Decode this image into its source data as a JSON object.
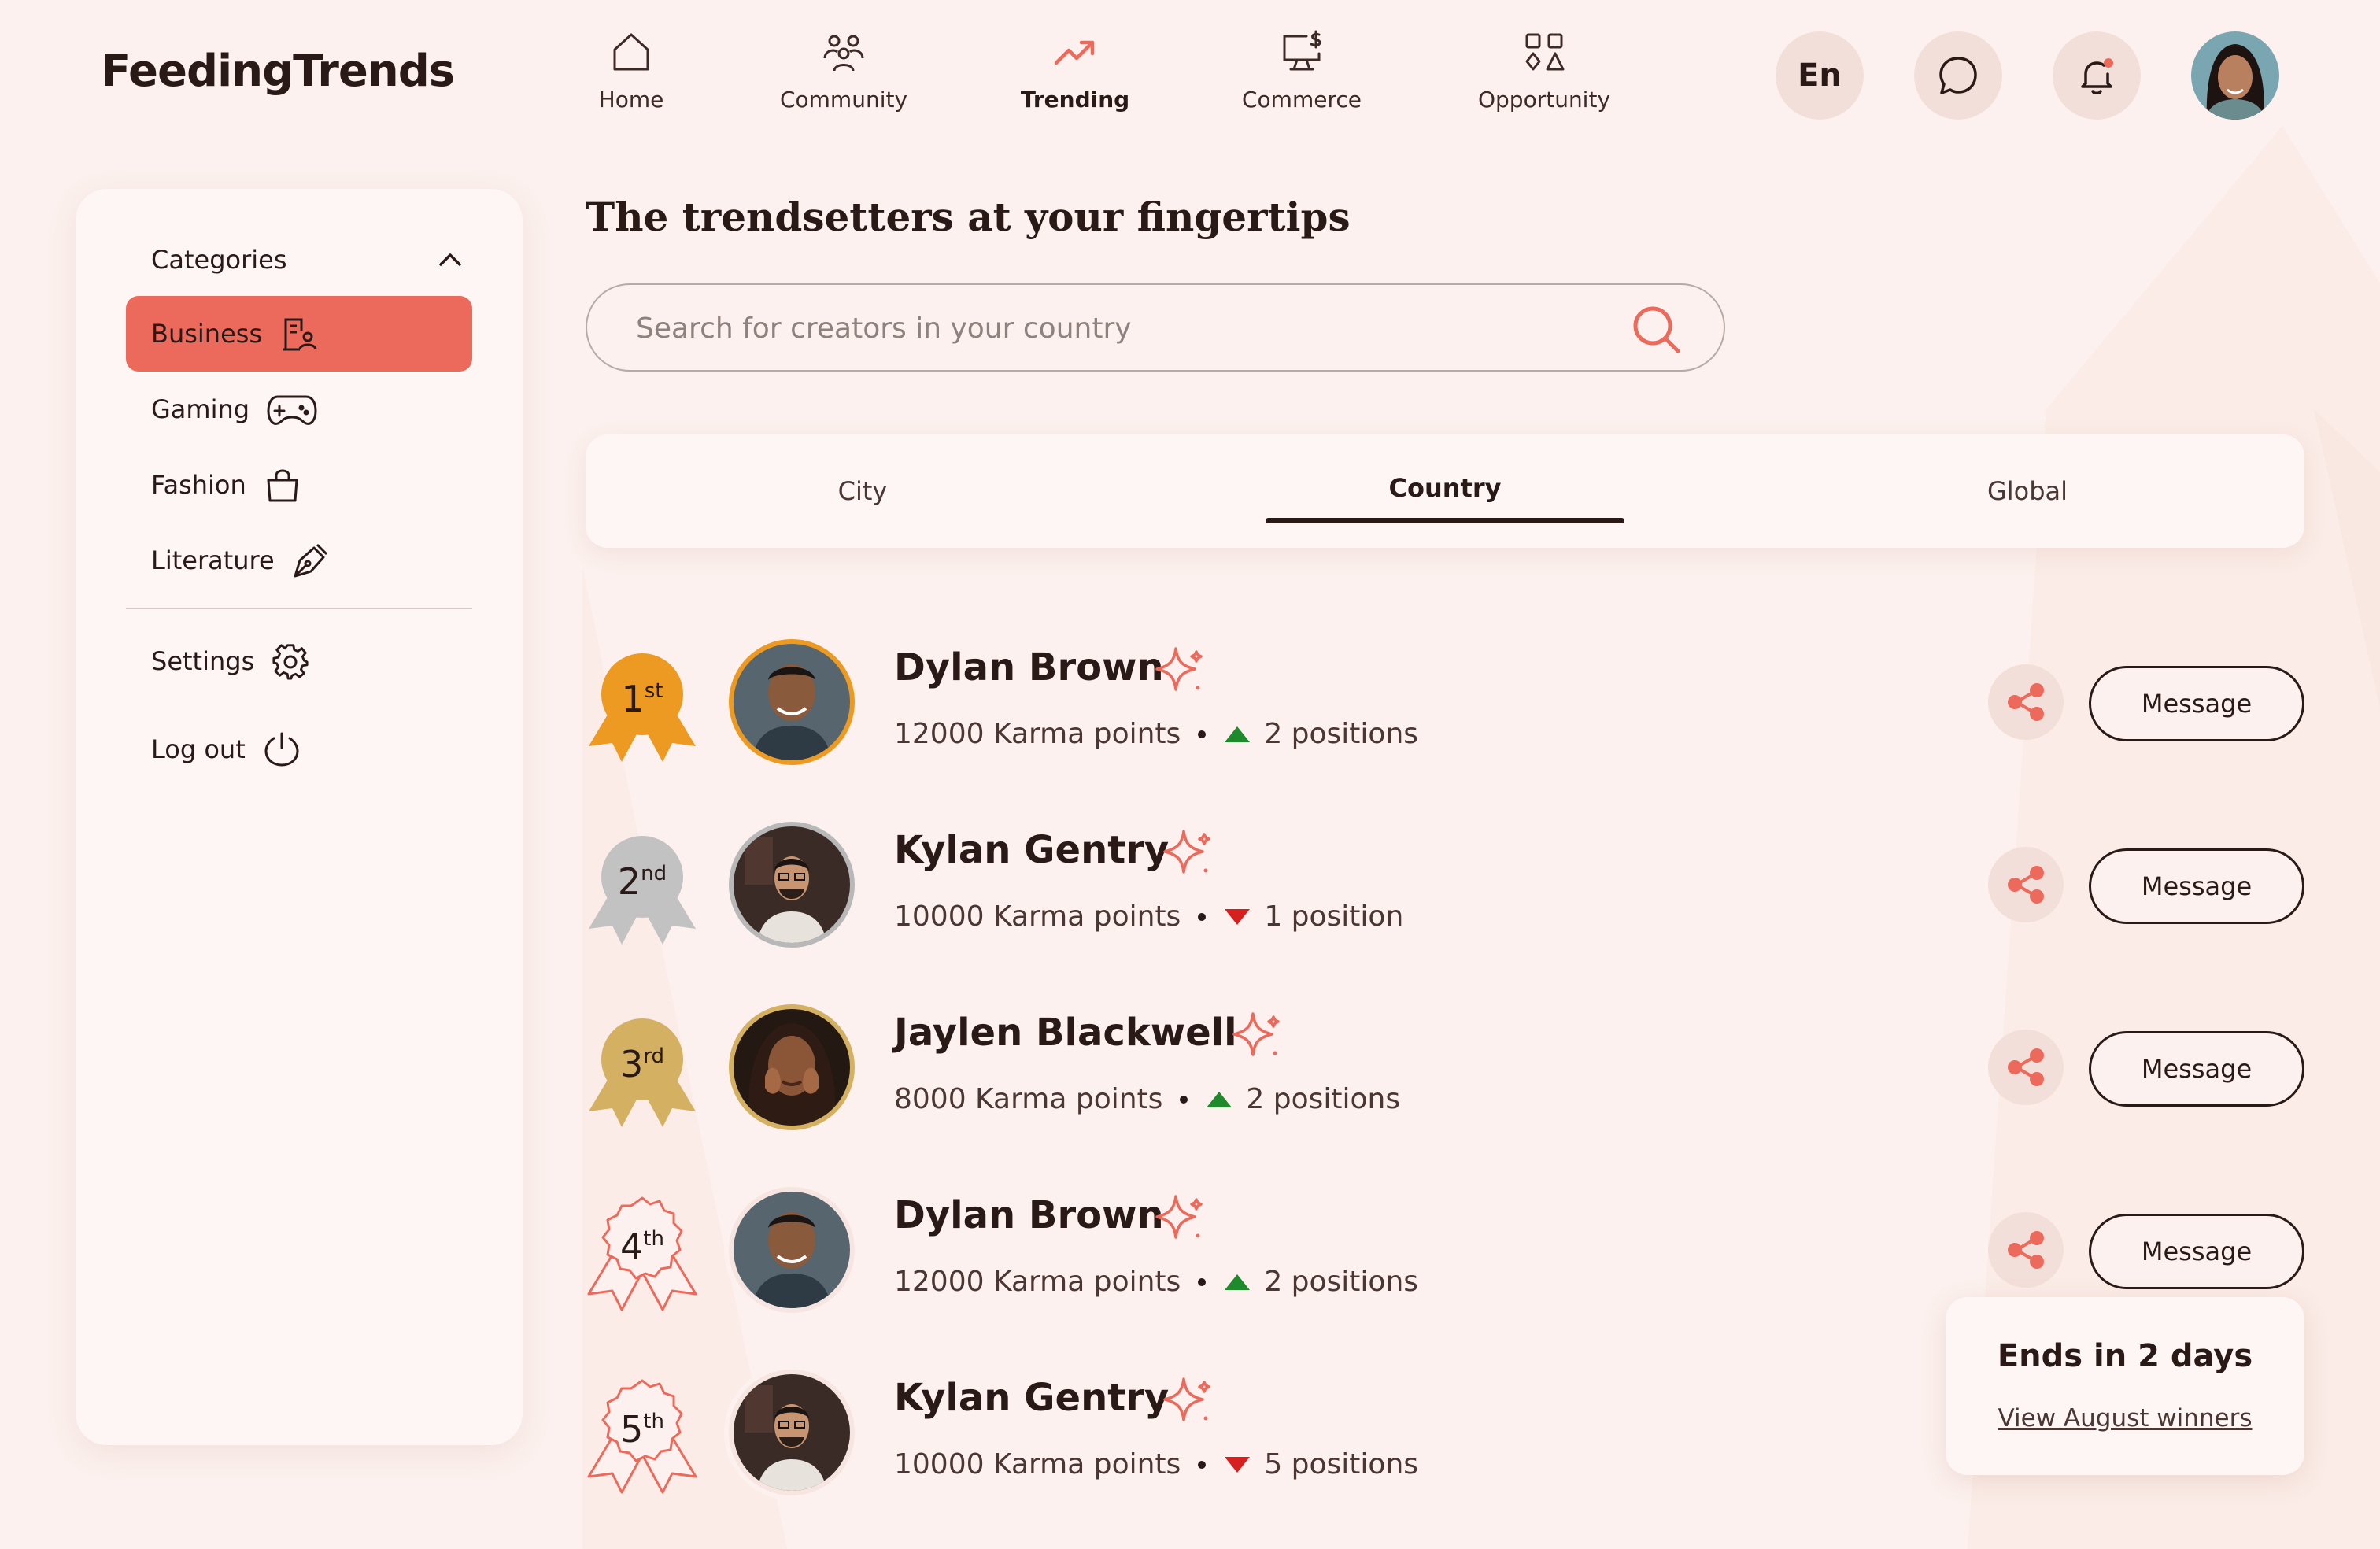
{
  "app": {
    "brand": "FeedingTrends"
  },
  "colors": {
    "background": "#fcf1ee",
    "accent": "#ec6a5c",
    "dark": "#2a1a17",
    "gold": "#ec9a22",
    "silver": "#c2c2c2",
    "bronze": "#d4b062",
    "up": "#1e8a2b",
    "down": "#d61f1f"
  },
  "nav": {
    "items": [
      {
        "label": "Home",
        "icon": "home-icon"
      },
      {
        "label": "Community",
        "icon": "community-icon"
      },
      {
        "label": "Trending",
        "icon": "trending-icon",
        "active": true
      },
      {
        "label": "Commerce",
        "icon": "commerce-icon"
      },
      {
        "label": "Opportunity",
        "icon": "opportunity-icon"
      }
    ],
    "language": "En"
  },
  "sidebar": {
    "categories_label": "Categories",
    "items": [
      {
        "label": "Business",
        "icon": "business-icon",
        "active": true
      },
      {
        "label": "Gaming",
        "icon": "gamepad-icon"
      },
      {
        "label": "Fashion",
        "icon": "shopping-bag-icon"
      },
      {
        "label": "Literature",
        "icon": "pen-icon"
      }
    ],
    "settings_label": "Settings",
    "logout_label": "Log out"
  },
  "main": {
    "headline": "The trendsetters at your fingertips",
    "search_placeholder": "Search for creators in your country",
    "tabs": [
      {
        "label": "City"
      },
      {
        "label": "Country",
        "active": true
      },
      {
        "label": "Global"
      }
    ]
  },
  "leaderboard": [
    {
      "rank": "1",
      "suffix": "st",
      "medal": "gold",
      "name": "Dylan Brown",
      "points": "12000 Karma points",
      "trend": "up",
      "change": "2 positions"
    },
    {
      "rank": "2",
      "suffix": "nd",
      "medal": "silver",
      "name": "Kylan Gentry",
      "points": "10000 Karma points",
      "trend": "down",
      "change": "1 position"
    },
    {
      "rank": "3",
      "suffix": "rd",
      "medal": "bronze",
      "name": "Jaylen Blackwell",
      "points": "8000 Karma points",
      "trend": "up",
      "change": "2 positions"
    },
    {
      "rank": "4",
      "suffix": "th",
      "medal": "outline",
      "name": "Dylan Brown",
      "points": "12000 Karma points",
      "trend": "up",
      "change": "2 positions"
    },
    {
      "rank": "5",
      "suffix": "th",
      "medal": "outline",
      "name": "Kylan Gentry",
      "points": "10000 Karma points",
      "trend": "down",
      "change": "5 positions"
    }
  ],
  "row_actions": {
    "message_label": "Message"
  },
  "ends_card": {
    "title": "Ends in  2 days",
    "link": "View August winners"
  }
}
